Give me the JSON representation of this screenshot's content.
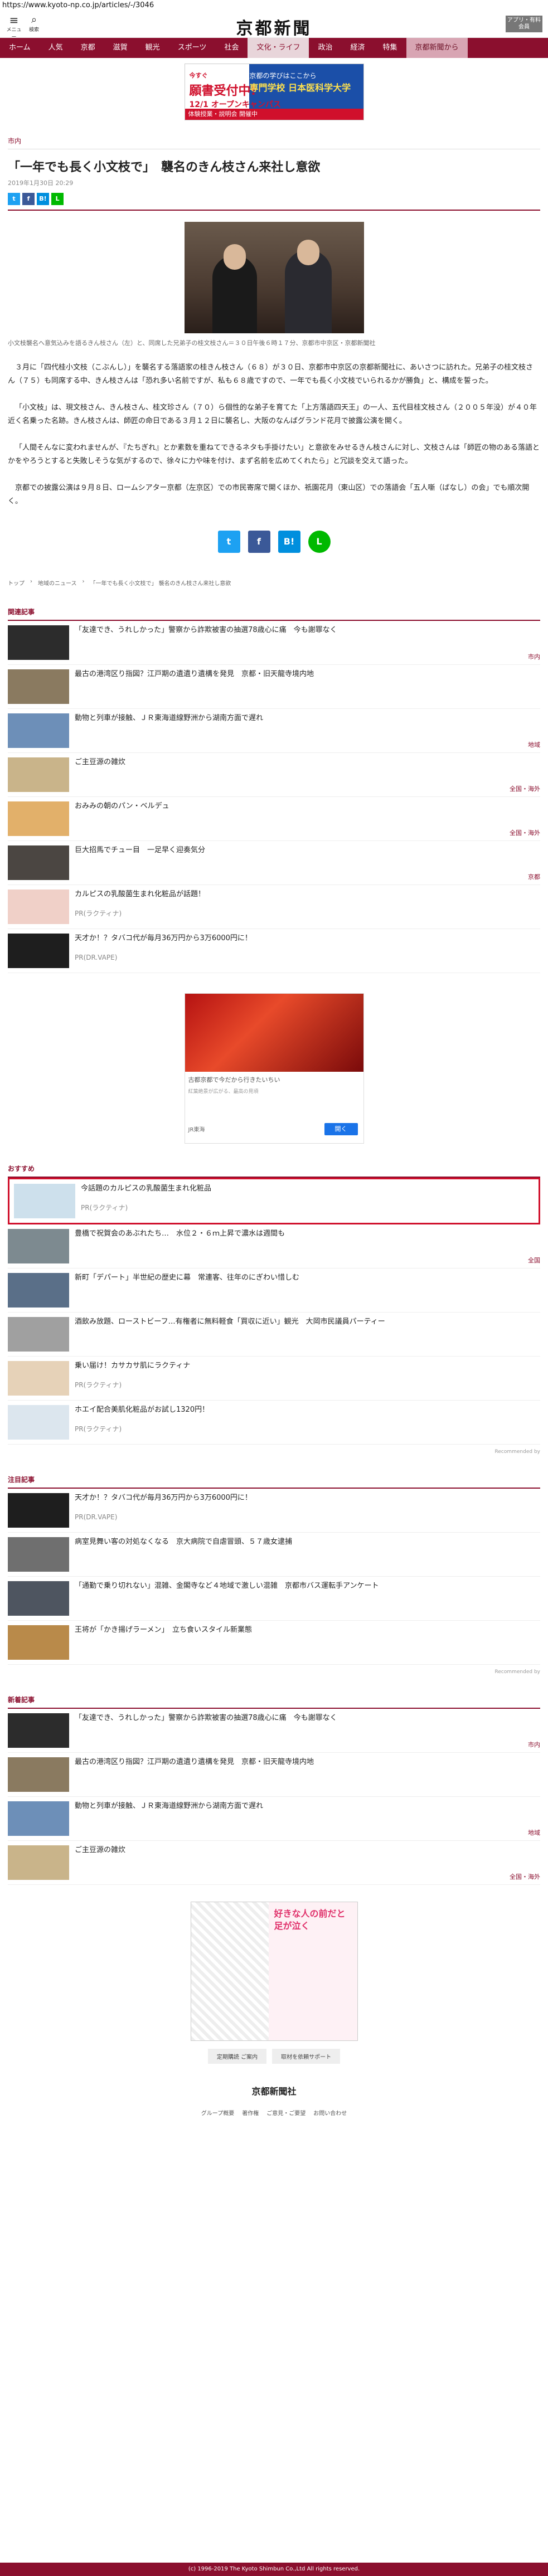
{
  "url": "https://www.kyoto-np.co.jp/articles/-/3046",
  "header": {
    "menu": "メニュー",
    "search": "検索",
    "logo": "京都新聞",
    "member_btn": "アプリ・有料会員"
  },
  "nav": [
    "ホーム",
    "人気",
    "京都",
    "滋賀",
    "観光",
    "スポーツ",
    "社会",
    "文化・ライフ",
    "政治",
    "経済",
    "特集",
    "京都新聞から"
  ],
  "top_ad": {
    "l1": "今すぐ",
    "l2": "願書受付中!",
    "l3": "12/1 オープンキャンパス",
    "r1": "京都の学びはここから",
    "r2": "専門学校 日本医科学大学",
    "bottom": "体験授業・説明会 開催中"
  },
  "article": {
    "category": "市内",
    "headline": "「一年でも長く小文枝で」　襲名のきん枝さん来社し意欲",
    "date": "2019年1月30日 20:29",
    "caption": "小文枝襲名へ意気込みを語るきん枝さん（左）と、同席した兄弟子の桂文枝さん＝３０日午後６時１７分、京都市中京区・京都新聞社",
    "paragraphs": [
      "３月に「四代桂小文枝（こぶんし）」を襲名する落語家の桂きん枝さん（６８）が３０日、京都市中京区の京都新聞社に、あいさつに訪れた。兄弟子の桂文枝さん（７５）も同席する中、きん枝さんは「恐れ多い名前ですが、私も６８歳ですので、一年でも長く小文枝でいられるかが勝負」と、構成を誓った。",
      "「小文枝」は、現文枝さん、きん枝さん、桂文珍さん（７０）ら個性的な弟子を育てた「上方落語四天王」の一人、五代目桂文枝さん（２００５年没）が４０年近く名乗った名跡。きん枝さんは、師匠の命日である３月１２日に襲名し、大阪のなんばグランド花月で披露公演を開く。",
      "「人間そんなに変われませんが、『たちぎれ』とか素数を重ねてできるネタも手掛けたい」と意欲をみせるきん枝さんに対し、文枝さんは「師匠の物のある落語とかをやろうとすると失敗しそうな気がするので、徐々に力や味を付け、まず名前を広めてくれたら」と冗談を交えて語った。",
      "京都での披露公演は９月８日、ロームシアター京都（左京区）での市民寄席で開くほか、祇園花月（東山区）での落語会「五人噺（ばなし）の会」でも順次開く。"
    ]
  },
  "breadcrumb": [
    "トップ",
    "地域のニュース",
    "「一年でも長く小文枝で」 襲名のきん枝さん来社し意欲"
  ],
  "related": {
    "title": "関連記事",
    "items": [
      {
        "text": "「友達でき、うれしかった」警察から詐欺被害の抽選78歳心に痛　今も謝罪なく",
        "tag": "市内"
      },
      {
        "text": "最古の港湾区り指図？江戸期の遺遺り遺構を発見　京都・旧天龍寺境内地",
        "tag": ""
      },
      {
        "text": "動物と列車が接触、ＪＲ東海道線野洲から湖南方面で遅れ",
        "tag": "地域"
      },
      {
        "text": "ご主豆源の雑炊",
        "tag": "全国・海外"
      },
      {
        "text": "おみみの朝のパン・ベルデュ",
        "tag": "全国・海外"
      },
      {
        "text": "巨大招馬でチュー目　一足早く迎奏気分",
        "tag": "京都"
      },
      {
        "text": "カルピスの乳酸菌生まれ化粧品が話題！",
        "pr": "PR(ラクティナ)"
      },
      {
        "text": "天才か！？タバコ代が毎月36万円から3万6000円に！",
        "pr": "PR(DR.VAPE)"
      }
    ]
  },
  "mid_ad": {
    "text": "古都京都で今だから行きたいちい",
    "sub": "紅葉絶景が広がる、最高の見頃",
    "src": "JR東海",
    "btn": "開く"
  },
  "recommend": {
    "title": "おすすめ",
    "items": [
      {
        "text": "今話題のカルピスの乳酸菌生まれ化粧品",
        "pr": "PR(ラクティナ)"
      },
      {
        "text": "豊橋で祝賀会のあぶれたち…　水位２・６ｍ上昇で濃水は週間も",
        "tag": "全国"
      },
      {
        "text": "新町「デパート」半世紀の歴史に幕　常連客、往年のにぎわい惜しむ",
        "tag": ""
      },
      {
        "text": "酒飲み放題、ローストビーフ…有権者に無料軽食「買収に近い」観光　大岡市民議員パーティー",
        "tag": ""
      },
      {
        "text": "乗い届け！カサカサ肌にラクティナ",
        "pr": "PR(ラクティナ)"
      },
      {
        "text": "ホエイ配合美肌化粧品がお試し1320円！",
        "pr": "PR(ラクティナ)"
      }
    ],
    "by": "Recommended by"
  },
  "attention": {
    "title": "注目記事",
    "items": [
      {
        "text": "天才か！？タバコ代が毎月36万円から3万6000円に！",
        "pr": "PR(DR.VAPE)"
      },
      {
        "text": "病室見舞い客の対処なくなる　京大病院で自虐冒頭、５７歳女逮捕",
        "tag": ""
      },
      {
        "text": "「通勤で乗り切れない」混雑、金閣寺など４地域で激しい混雑　京都市バス運転手アンケート",
        "tag": ""
      },
      {
        "text": "王将が「かき揚げラーメン」　立ち食いスタイル新業態",
        "tag": ""
      }
    ],
    "by": "Recommended by"
  },
  "newest": {
    "title": "新着記事",
    "items": [
      {
        "text": "「友達でき、うれしかった」警察から詐欺被害の抽選78歳心に痛　今も謝罪なく",
        "tag": "市内"
      },
      {
        "text": "最古の港湾区り指図？江戸期の遺遺り遺構を発見　京都・旧天龍寺境内地",
        "tag": ""
      },
      {
        "text": "動物と列車が接触、ＪＲ東海道線野洲から湖南方面で遅れ",
        "tag": "地域"
      },
      {
        "text": "ご主豆源の雑炊",
        "tag": "全国・海外"
      }
    ]
  },
  "bottom_ad": {
    "text": "好きな人の前だと足が泣く"
  },
  "bottom_btns": [
    "定期購読 ご案内",
    "取材を依頼サポート"
  ],
  "footer": {
    "logo": "京都新聞社",
    "links": [
      "グループ概要",
      "著作権",
      "ご意見・ご要望",
      "お問い合わせ"
    ],
    "copyright": "(c) 1996-2019 The Kyoto Shimbun Co.,Ltd All rights reserved."
  }
}
